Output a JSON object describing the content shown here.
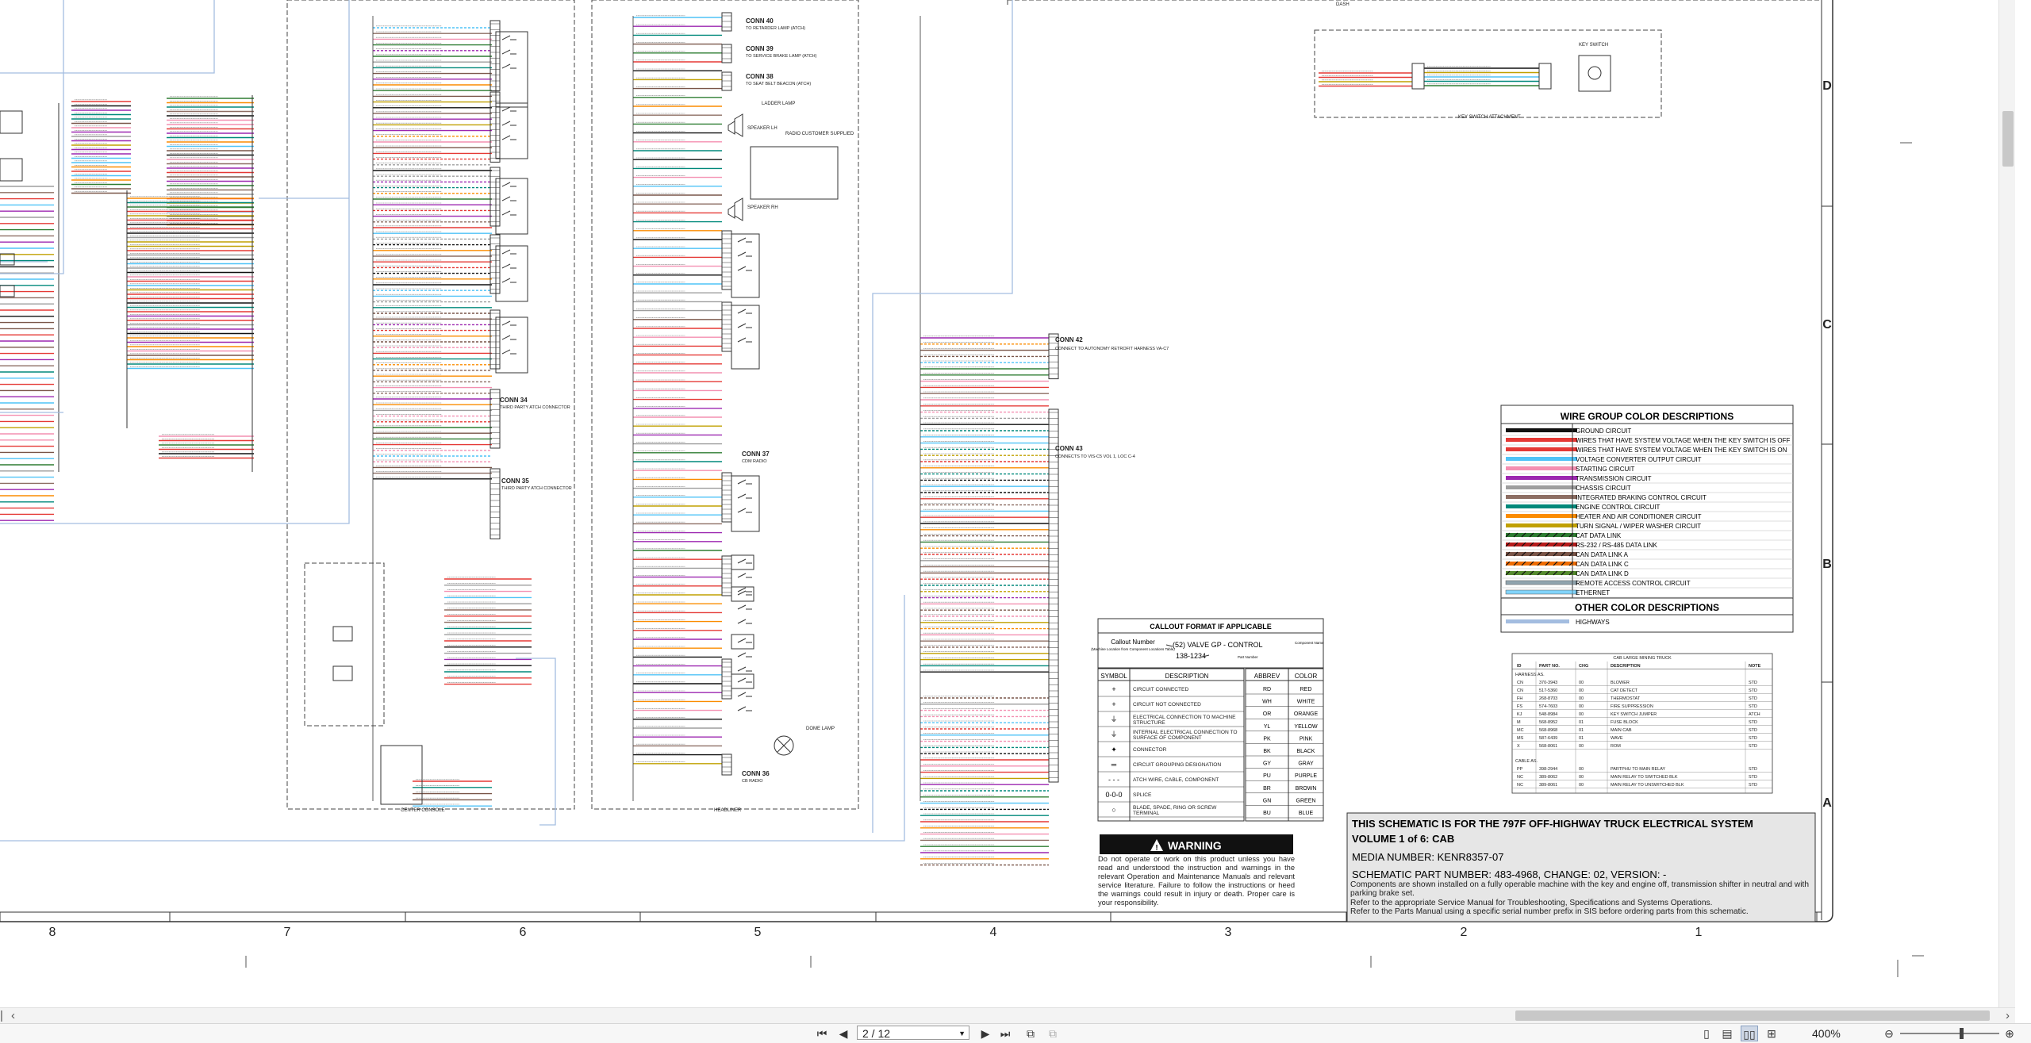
{
  "grid": {
    "columns": [
      "8",
      "7",
      "6",
      "5",
      "4",
      "3",
      "2",
      "1"
    ],
    "rows": [
      "D",
      "C",
      "B",
      "A"
    ]
  },
  "connectors": [
    {
      "name": "CONN 40",
      "desc": "TO RETARDER LAMP (ATCH)"
    },
    {
      "name": "CONN 39",
      "desc": "TO SERVICE BRAKE LAMP (ATCH)"
    },
    {
      "name": "CONN 38",
      "desc": "TO SEAT BELT BEACON (ATCH)"
    },
    {
      "name": "CONN 34",
      "desc": "THIRD PARTY ATCH CONNECTOR"
    },
    {
      "name": "CONN 35",
      "desc": "THIRD PARTY ATCH CONNECTOR"
    },
    {
      "name": "CONN 37",
      "desc": "CDM RADIO"
    },
    {
      "name": "CONN 36",
      "desc": "CB RADIO"
    },
    {
      "name": "CONN 42",
      "desc": "CONNECT TO AUTONOMY RETROFIT HARNESS VA-C7"
    },
    {
      "name": "CONN 43",
      "desc": "CONNECTS TO VIS-C5 VOL 1, LOC C-4"
    }
  ],
  "labels": {
    "center_console": "CENTER CONSOLE",
    "headliner": "HEADLINER",
    "key_switch_attachment": "KEY SWITCH ATTACHMENT",
    "key_switch": "KEY SWITCH",
    "dash": "DASH",
    "speaker_lh": "SPEAKER LH",
    "speaker_rh": "SPEAKER RH",
    "radio": "RADIO CUSTOMER SUPPLIED",
    "ladder_lamp": "LADDER LAMP",
    "dome_lamp": "DOME LAMP"
  },
  "wire_group": {
    "title": "WIRE GROUP COLOR DESCRIPTIONS",
    "items": [
      {
        "color": "#111111",
        "label": "GROUND CIRCUIT"
      },
      {
        "color": "#e53935",
        "label": "WIRES THAT HAVE SYSTEM VOLTAGE WHEN THE KEY SWITCH IS OFF"
      },
      {
        "color": "#e53935",
        "label": "WIRES THAT HAVE SYSTEM VOLTAGE WHEN THE KEY SWITCH IS ON"
      },
      {
        "color": "#4fc3f7",
        "label": "VOLTAGE CONVERTER OUTPUT CIRCUIT"
      },
      {
        "color": "#f48fb1",
        "label": "STARTING CIRCUIT"
      },
      {
        "color": "#9c27b0",
        "label": "TRANSMISSION CIRCUIT"
      },
      {
        "color": "#9e9e9e",
        "label": "CHASSIS CIRCUIT"
      },
      {
        "color": "#8d6e63",
        "label": "INTEGRATED BRAKING CONTROL CIRCUIT"
      },
      {
        "color": "#00897b",
        "label": "ENGINE CONTROL CIRCUIT"
      },
      {
        "color": "#fb8c00",
        "label": "HEATER AND AIR CONDITIONER CIRCUIT"
      },
      {
        "color": "#c0a000",
        "label": "TURN SIGNAL / WIPER WASHER CIRCUIT"
      },
      {
        "color": "#2e7d32",
        "label": "CAT DATA LINK"
      },
      {
        "color": "#b71c1c",
        "label": "RS-232 / RS-485 DATA LINK"
      },
      {
        "color": "#795548",
        "label": "CAN DATA LINK A"
      },
      {
        "color": "#ef6c00",
        "label": "CAN DATA LINK C"
      },
      {
        "color": "#558b2f",
        "label": "CAN DATA LINK D"
      },
      {
        "color": "#90a4ae",
        "label": "REMOTE ACCESS CONTROL CIRCUIT"
      },
      {
        "color": "#81d4fa",
        "label": "ETHERNET"
      }
    ],
    "other_title": "OTHER COLOR DESCRIPTIONS",
    "other_items": [
      {
        "color": "#a3bde0",
        "label": "HIGHWAYS"
      }
    ]
  },
  "callout": {
    "title": "CALLOUT FORMAT IF APPLICABLE",
    "callout_number": "Callout Number",
    "callout_sub": "(Machine Location from Component Locations Table)",
    "example": "(52) VALVE GP - CONTROL",
    "component_name": "Component Name",
    "part_number": "138-1234",
    "part_number_label": "Part Number"
  },
  "symbols": {
    "headers": [
      "SYMBOL",
      "DESCRIPTION"
    ],
    "rows": [
      {
        "sym": "+",
        "desc": "CIRCUIT CONNECTED"
      },
      {
        "sym": "+",
        "desc": "CIRCUIT NOT CONNECTED"
      },
      {
        "sym": "⏚",
        "desc": "ELECTRICAL CONNECTION TO MACHINE STRUCTURE"
      },
      {
        "sym": "⏚",
        "desc": "INTERNAL ELECTRICAL CONNECTION TO SURFACE OF COMPONENT"
      },
      {
        "sym": "✦",
        "desc": "CONNECTOR"
      },
      {
        "sym": "═",
        "desc": "CIRCUIT GROUPING DESIGNATION"
      },
      {
        "sym": "- - -",
        "desc": "ATCH WIRE, CABLE, COMPONENT"
      },
      {
        "sym": "0-0-0",
        "desc": "SPLICE"
      },
      {
        "sym": "○",
        "desc": "BLADE, SPADE, RING OR SCREW TERMINAL"
      }
    ]
  },
  "abbrev": {
    "headers": [
      "ABBREV",
      "COLOR"
    ],
    "rows": [
      [
        "RD",
        "RED"
      ],
      [
        "WH",
        "WHITE"
      ],
      [
        "OR",
        "ORANGE"
      ],
      [
        "YL",
        "YELLOW"
      ],
      [
        "PK",
        "PINK"
      ],
      [
        "BK",
        "BLACK"
      ],
      [
        "GY",
        "GRAY"
      ],
      [
        "PU",
        "PURPLE"
      ],
      [
        "BR",
        "BROWN"
      ],
      [
        "GN",
        "GREEN"
      ],
      [
        "BU",
        "BLUE"
      ]
    ]
  },
  "warning": {
    "title": "WARNING",
    "text": "Do not operate or work on this product unless you have read and understood the instruction and warnings in the relevant Operation and Maintenance Manuals and relevant service literature. Failure to follow the instructions or heed the warnings could result in injury or death. Proper care is your responsibility."
  },
  "title_block": {
    "line1": "THIS SCHEMATIC IS FOR THE 797F OFF-HIGHWAY TRUCK ELECTRICAL SYSTEM",
    "line2": "VOLUME 1 of 6: CAB",
    "media": "MEDIA NUMBER: KENR8357-07",
    "part": "SCHEMATIC PART NUMBER: 483-4968, CHANGE: 02, VERSION: -",
    "note1": "Components are shown installed on a fully operable machine with the key and engine off, transmission shifter in neutral and with parking brake set.",
    "note2": "Refer to the appropriate Service Manual for Troubleshooting, Specifications and Systems Operations.",
    "note3": "Refer to the Parts Manual using a specific serial number prefix in SIS before ordering parts from this schematic."
  },
  "harness_table": {
    "title": "CAB LARGE MINING TRUCK",
    "headers": [
      "ID",
      "PART NO.",
      "CHG",
      "DESCRIPTION",
      "NOTE"
    ],
    "group1": "HARNESS AS.",
    "rows1": [
      [
        "CN",
        "370-3943",
        "00",
        "BLOWER",
        "STD"
      ],
      [
        "CN",
        "517-5360",
        "00",
        "CAT DETECT",
        "STD"
      ],
      [
        "FH",
        "268-8703",
        "00",
        "THERMOSTAT",
        "STD"
      ],
      [
        "FS",
        "574-7603",
        "00",
        "FIRE SUPPRESSION",
        "STD"
      ],
      [
        "KJ",
        "548-8984",
        "00",
        "KEY SWITCH JUMPER",
        "ATCH"
      ],
      [
        "M",
        "568-8952",
        "01",
        "FUSE BLOCK",
        "STD"
      ],
      [
        "MC",
        "568-8968",
        "01",
        "MAIN CAB",
        "STD"
      ],
      [
        "MS",
        "587-6439",
        "01",
        "WAVE",
        "STD"
      ],
      [
        "X",
        "568-8061",
        "00",
        "ROM",
        "STD"
      ]
    ],
    "group2": "CABLE AS.",
    "rows2": [
      [
        "PP",
        "398-2944",
        "00",
        "PARTPHU TO MAIN RELAY",
        "STD"
      ],
      [
        "NC",
        "389-8062",
        "00",
        "MAIN RELAY TO SWITCHED BLK",
        "STD"
      ],
      [
        "NC",
        "389-8061",
        "00",
        "MAIN RELAY TO UNSWITCHED BLK",
        "STD"
      ]
    ]
  },
  "viewer": {
    "page_current": "2 / 12",
    "zoom": "400%",
    "zoom_fraction": 0.6,
    "vscroll_fraction": 0.13,
    "hscroll_fraction": 0.76
  }
}
